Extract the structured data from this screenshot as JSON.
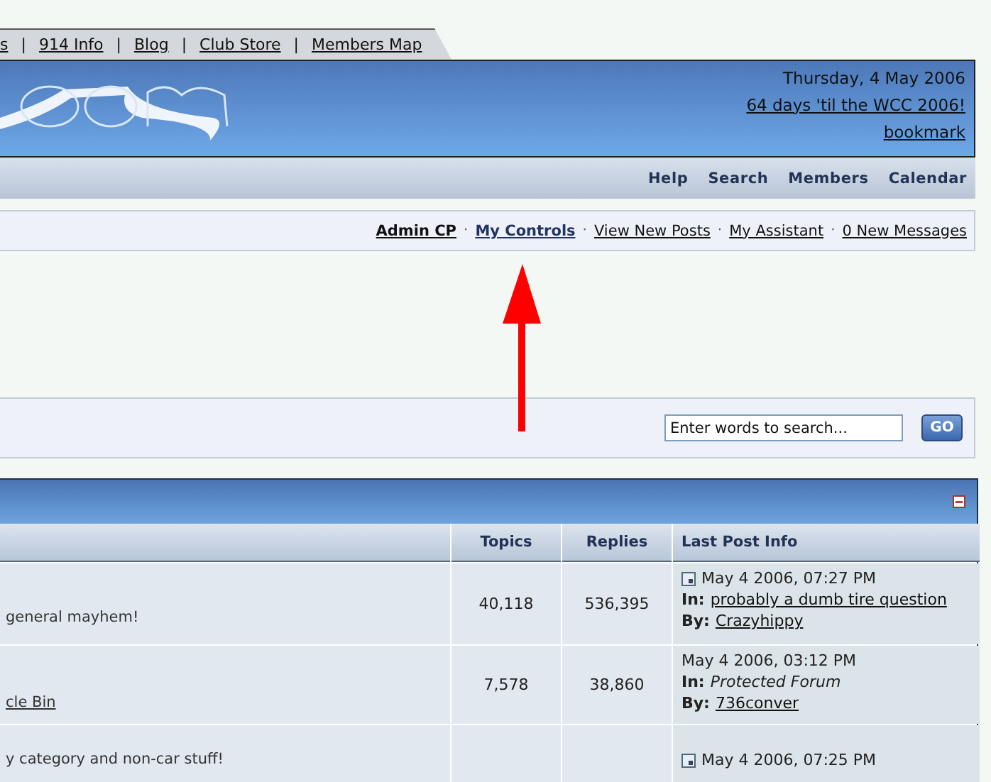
{
  "top_links": {
    "separator": "|",
    "items": [
      {
        "label": "s"
      },
      {
        "label": "914 Info"
      },
      {
        "label": "Blog"
      },
      {
        "label": "Club Store"
      },
      {
        "label": "Members Map"
      }
    ]
  },
  "header": {
    "date": "Thursday, 4 May 2006",
    "countdown_link": "64 days 'til the WCC 2006!",
    "bookmark_link": "bookmark"
  },
  "nav": [
    "Help",
    "Search",
    "Members",
    "Calendar"
  ],
  "user_bar": {
    "separator": "·",
    "links": [
      {
        "label": "Admin CP",
        "kind": "admin"
      },
      {
        "label": "My Controls",
        "kind": "highlight"
      },
      {
        "label": "View New Posts",
        "kind": "plain"
      },
      {
        "label": "My Assistant",
        "kind": "plain"
      },
      {
        "label": "0 New Messages",
        "kind": "plain"
      }
    ]
  },
  "search": {
    "placeholder": "Enter words to search...",
    "button": "GO"
  },
  "forum_table": {
    "columns": [
      "Topics",
      "Replies",
      "Last Post Info"
    ],
    "rows": [
      {
        "description": {
          "text": "general mayhem!",
          "kind": "text"
        },
        "topics": "40,118",
        "replies": "536,395",
        "last_post": {
          "new_icon": true,
          "date": "May 4 2006, 07:27 PM",
          "in_label": "In:",
          "in_topic": {
            "title": "probably a dumb tire question",
            "kind": "link"
          },
          "by_label": "By:",
          "by": "Crazyhippy"
        }
      },
      {
        "description": {
          "text": "cle Bin",
          "kind": "link"
        },
        "topics": "7,578",
        "replies": "38,860",
        "last_post": {
          "new_icon": false,
          "date": "May 4 2006, 03:12 PM",
          "in_label": "In:",
          "in_topic": {
            "title": "Protected Forum",
            "kind": "protected"
          },
          "by_label": "By:",
          "by": "736conver"
        }
      },
      {
        "description": {
          "text": "y category and non-car stuff!",
          "kind": "text"
        },
        "last_post": {
          "new_icon": true,
          "date": "May 4 2006, 07:25 PM"
        }
      }
    ]
  }
}
